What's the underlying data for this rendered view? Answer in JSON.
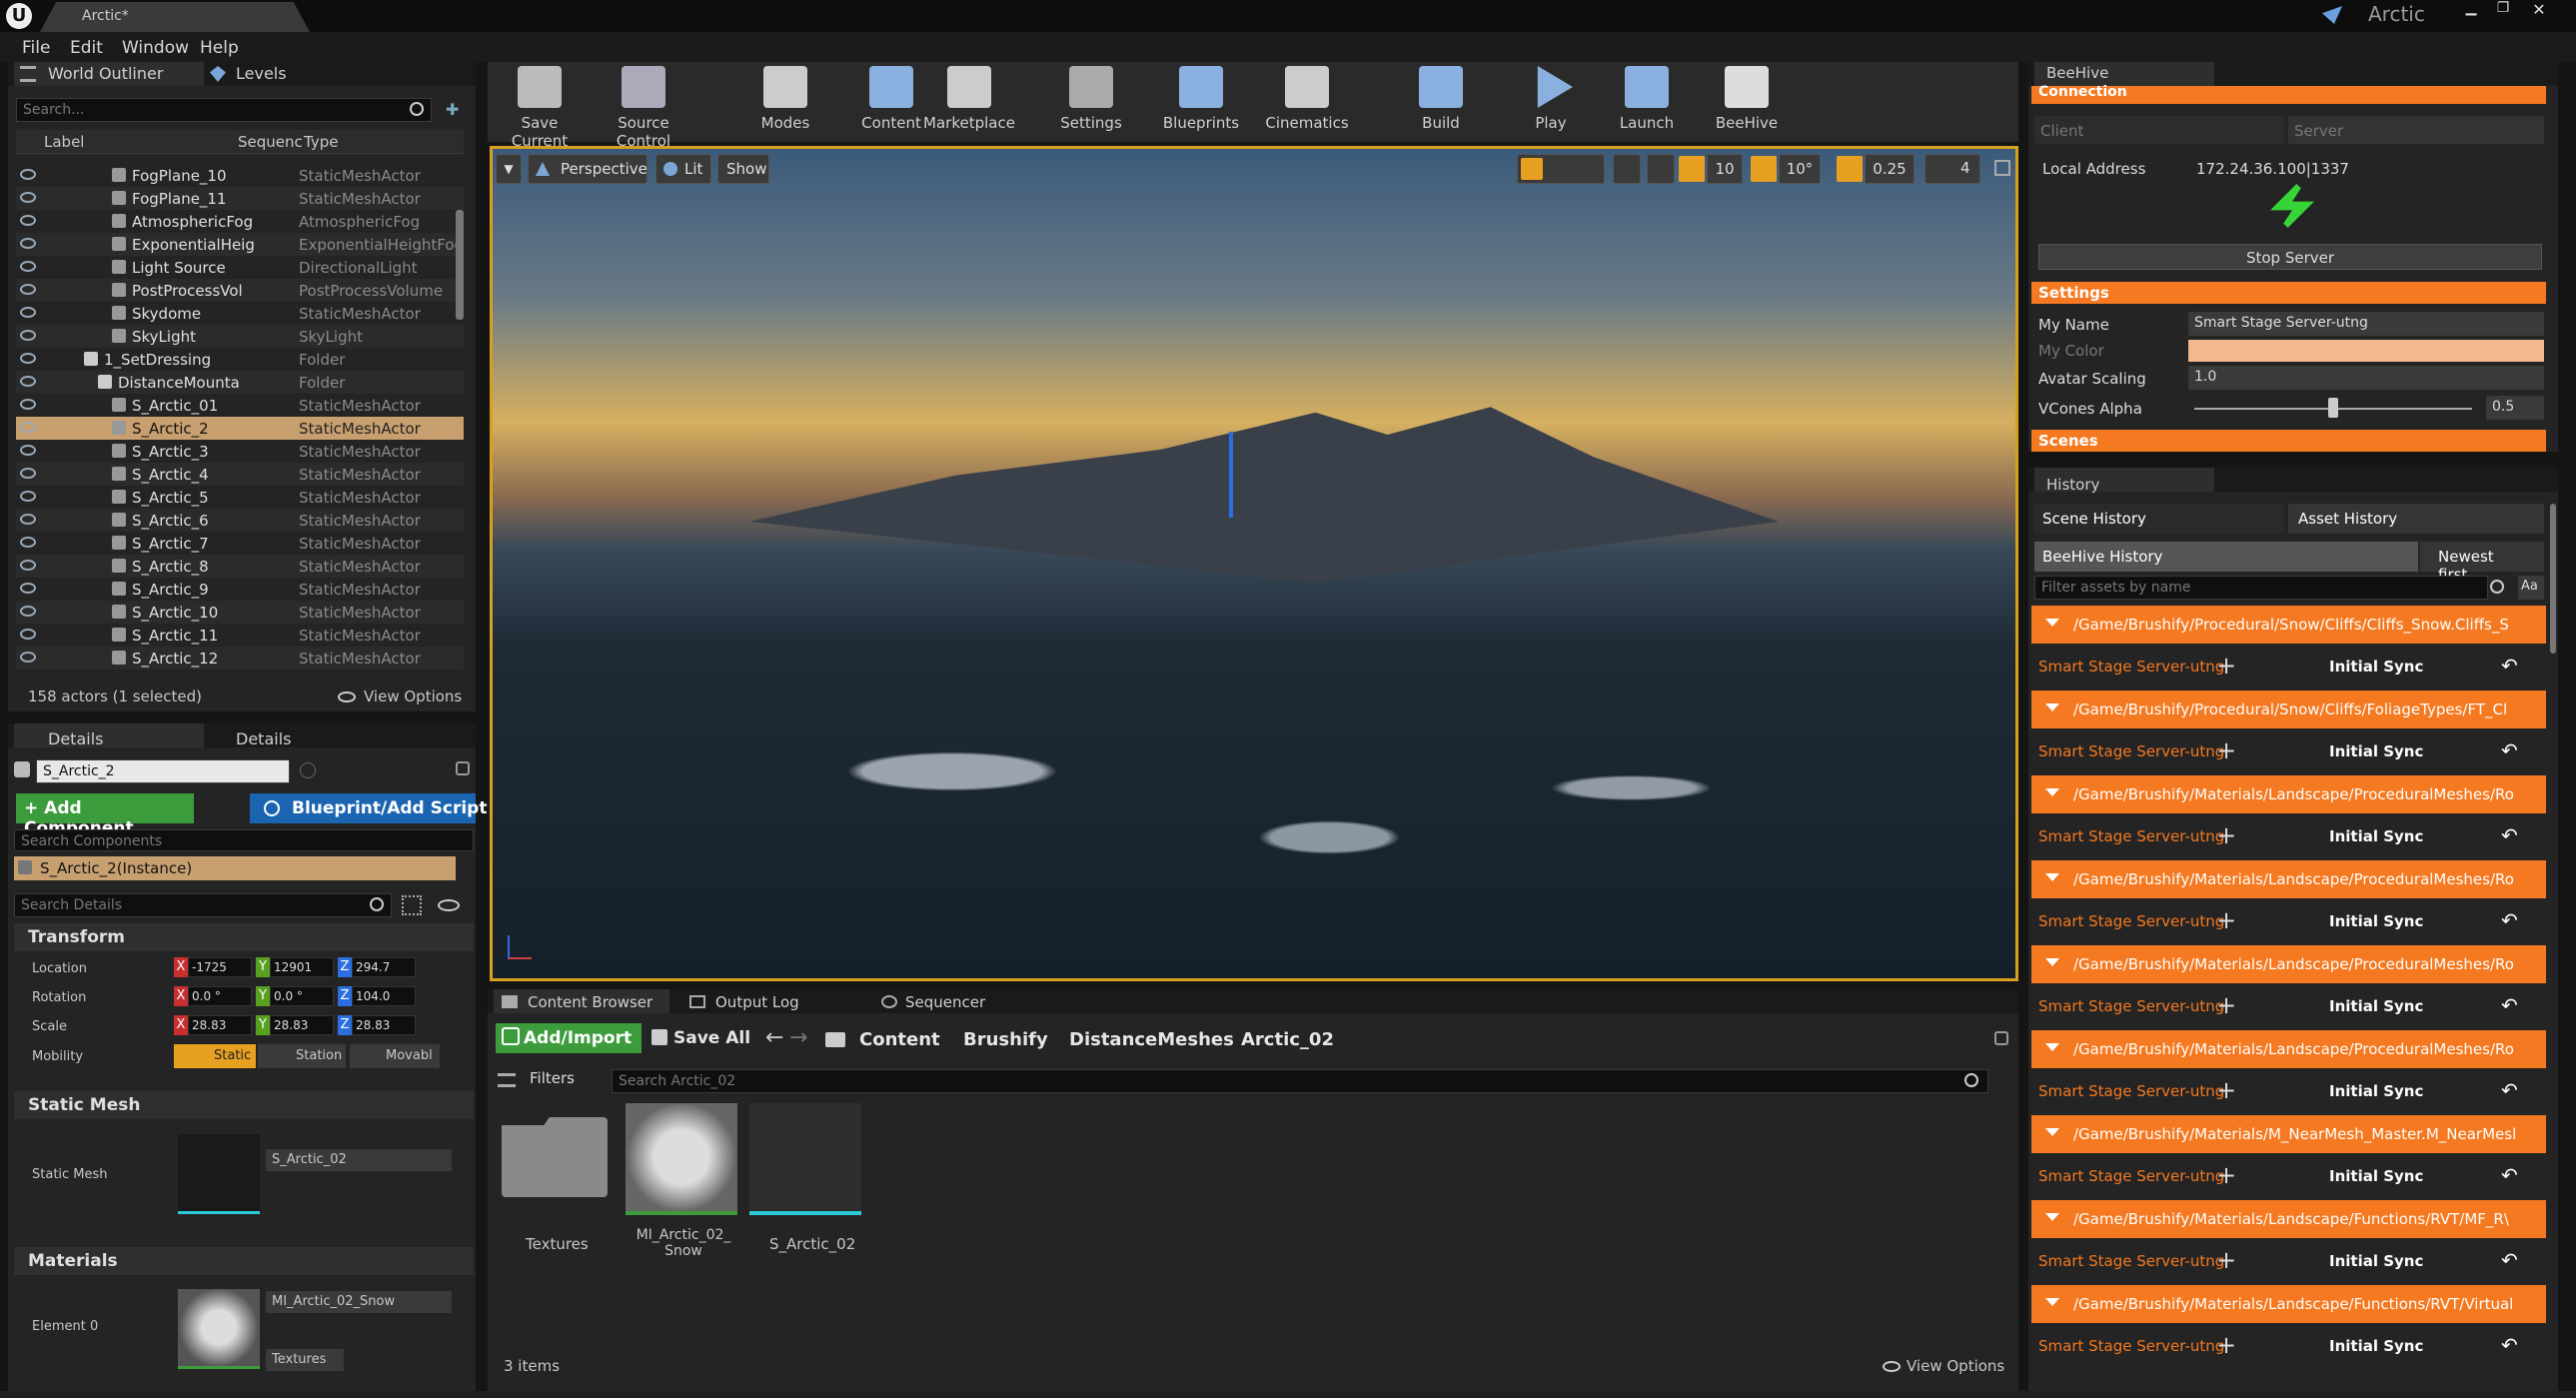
{
  "window": {
    "tab_title": "Arctic*",
    "app_title": "Arctic"
  },
  "menu": [
    "File",
    "Edit",
    "Window",
    "Help"
  ],
  "outliner": {
    "tabs": [
      "World Outliner",
      "Levels"
    ],
    "search_placeholder": "Search...",
    "columns": {
      "label": "Label",
      "sequence": "Sequenc",
      "type": "Type"
    },
    "rows": [
      {
        "label": "FogPlane_10",
        "type": "StaticMeshActor"
      },
      {
        "label": "FogPlane_11",
        "type": "StaticMeshActor"
      },
      {
        "label": "AtmosphericFog",
        "type": "AtmosphericFog"
      },
      {
        "label": "ExponentialHeig",
        "type": "ExponentialHeightFog"
      },
      {
        "label": "Light Source",
        "type": "DirectionalLight"
      },
      {
        "label": "PostProcessVol",
        "type": "PostProcessVolume"
      },
      {
        "label": "Skydome",
        "type": "StaticMeshActor"
      },
      {
        "label": "SkyLight",
        "type": "SkyLight"
      },
      {
        "label": "1_SetDressing",
        "type": "Folder"
      },
      {
        "label": "DistanceMounta",
        "type": "Folder"
      },
      {
        "label": "S_Arctic_01",
        "type": "StaticMeshActor"
      },
      {
        "label": "S_Arctic_2",
        "type": "StaticMeshActor"
      },
      {
        "label": "S_Arctic_3",
        "type": "StaticMeshActor"
      },
      {
        "label": "S_Arctic_4",
        "type": "StaticMeshActor"
      },
      {
        "label": "S_Arctic_5",
        "type": "StaticMeshActor"
      },
      {
        "label": "S_Arctic_6",
        "type": "StaticMeshActor"
      },
      {
        "label": "S_Arctic_7",
        "type": "StaticMeshActor"
      },
      {
        "label": "S_Arctic_8",
        "type": "StaticMeshActor"
      },
      {
        "label": "S_Arctic_9",
        "type": "StaticMeshActor"
      },
      {
        "label": "S_Arctic_10",
        "type": "StaticMeshActor"
      },
      {
        "label": "S_Arctic_11",
        "type": "StaticMeshActor"
      },
      {
        "label": "S_Arctic_12",
        "type": "StaticMeshActor"
      }
    ],
    "status": "158 actors (1 selected)",
    "view_options": "View Options"
  },
  "details": {
    "tabs": [
      "Details",
      "Details"
    ],
    "actor_name": "S_Arctic_2",
    "add_component": "+ Add Component",
    "blueprint": "Blueprint/Add Script",
    "search_components": "Search Components",
    "instance": "S_Arctic_2(Instance)",
    "search_details": "Search Details",
    "transform_header": "Transform",
    "location_label": "Location",
    "rotation_label": "Rotation",
    "scale_label": "Scale",
    "mobility_label": "Mobility",
    "location": [
      "-1725",
      "12901",
      "294.7"
    ],
    "rotation": [
      "0.0 °",
      "0.0 °",
      "104.0"
    ],
    "scale": [
      "28.83",
      "28.83",
      "28.83"
    ],
    "mobility": [
      "Static",
      "Station",
      "Movabl"
    ],
    "static_mesh_header": "Static Mesh",
    "static_mesh_label": "Static Mesh",
    "static_mesh_value": "S_Arctic_02",
    "materials_header": "Materials",
    "element0_label": "Element 0",
    "material_value": "MI_Arctic_02_Snow",
    "textures_btn": "Textures"
  },
  "toolbar": [
    {
      "label": "Save Current",
      "icon": "save-icon"
    },
    {
      "label": "Source Control",
      "icon": "source-control-icon"
    },
    {
      "label": "Modes",
      "icon": "modes-icon"
    },
    {
      "label": "Content",
      "icon": "content-icon"
    },
    {
      "label": "Marketplace",
      "icon": "marketplace-icon"
    },
    {
      "label": "Settings",
      "icon": "settings-icon"
    },
    {
      "label": "Blueprints",
      "icon": "blueprints-icon"
    },
    {
      "label": "Cinematics",
      "icon": "cinematics-icon"
    },
    {
      "label": "Build",
      "icon": "build-icon"
    },
    {
      "label": "Play",
      "icon": "play-icon"
    },
    {
      "label": "Launch",
      "icon": "launch-icon"
    },
    {
      "label": "BeeHive",
      "icon": "beehive-icon"
    }
  ],
  "viewport": {
    "perspective": "Perspective",
    "lit": "Lit",
    "show": "Show",
    "grid_snap": "10",
    "rot_snap": "10°",
    "scale_snap": "0.25",
    "cam_speed": "4"
  },
  "content_browser": {
    "tabs": [
      "Content Browser",
      "Output Log",
      "Sequencer"
    ],
    "add_import": "Add/Import",
    "save_all": "Save All",
    "breadcrumbs": [
      "Content",
      "Brushify",
      "DistanceMeshes",
      "Arctic_02"
    ],
    "filters": "Filters",
    "search_placeholder": "Search Arctic_02",
    "items": [
      "Textures",
      "MI_Arctic_02_Snow",
      "S_Arctic_02"
    ],
    "count": "3 items",
    "view_options": "View Options"
  },
  "beehive": {
    "tab": "BeeHive",
    "connection_header": "Connection",
    "client": "Client",
    "server": "Server",
    "local_address_label": "Local Address",
    "local_address": "172.24.36.100|1337",
    "stop_server": "Stop Server",
    "settings_header": "Settings",
    "my_name_label": "My Name",
    "my_name": "Smart Stage Server-utng",
    "my_color_label": "My Color",
    "avatar_scaling_label": "Avatar Scaling",
    "avatar_scaling": "1.0",
    "vcones_label": "VCones Alpha",
    "vcones_value": "0.5",
    "vcones_level": 0.5,
    "scenes_header": "Scenes",
    "colors": {
      "accent": "#f47920",
      "plug": "#36d436"
    }
  },
  "history": {
    "tab": "History",
    "scene_history": "Scene History",
    "asset_history": "Asset History",
    "beehive_history": "BeeHive History",
    "newest_first": "Newest first",
    "filter_placeholder": "Filter assets by name",
    "case_btn": "Aa",
    "entries": [
      {
        "path": "/Game/Brushify/Procedural/Snow/Cliffs/Cliffs_Snow.Cliffs_S",
        "user": "Smart Stage Server-utng",
        "status": "Initial Sync"
      },
      {
        "path": "/Game/Brushify/Procedural/Snow/Cliffs/FoliageTypes/FT_Cl",
        "user": "Smart Stage Server-utng",
        "status": "Initial Sync"
      },
      {
        "path": "/Game/Brushify/Materials/Landscape/ProceduralMeshes/Ro",
        "user": "Smart Stage Server-utng",
        "status": "Initial Sync"
      },
      {
        "path": "/Game/Brushify/Materials/Landscape/ProceduralMeshes/Ro",
        "user": "Smart Stage Server-utng",
        "status": "Initial Sync"
      },
      {
        "path": "/Game/Brushify/Materials/Landscape/ProceduralMeshes/Ro",
        "user": "Smart Stage Server-utng",
        "status": "Initial Sync"
      },
      {
        "path": "/Game/Brushify/Materials/Landscape/ProceduralMeshes/Ro",
        "user": "Smart Stage Server-utng",
        "status": "Initial Sync"
      },
      {
        "path": "/Game/Brushify/Materials/M_NearMesh_Master.M_NearMesl",
        "user": "Smart Stage Server-utng",
        "status": "Initial Sync"
      },
      {
        "path": "/Game/Brushify/Materials/Landscape/Functions/RVT/MF_R\\",
        "user": "Smart Stage Server-utng",
        "status": "Initial Sync"
      },
      {
        "path": "/Game/Brushify/Materials/Landscape/Functions/RVT/Virtual",
        "user": "Smart Stage Server-utng",
        "status": "Initial Sync"
      }
    ]
  }
}
